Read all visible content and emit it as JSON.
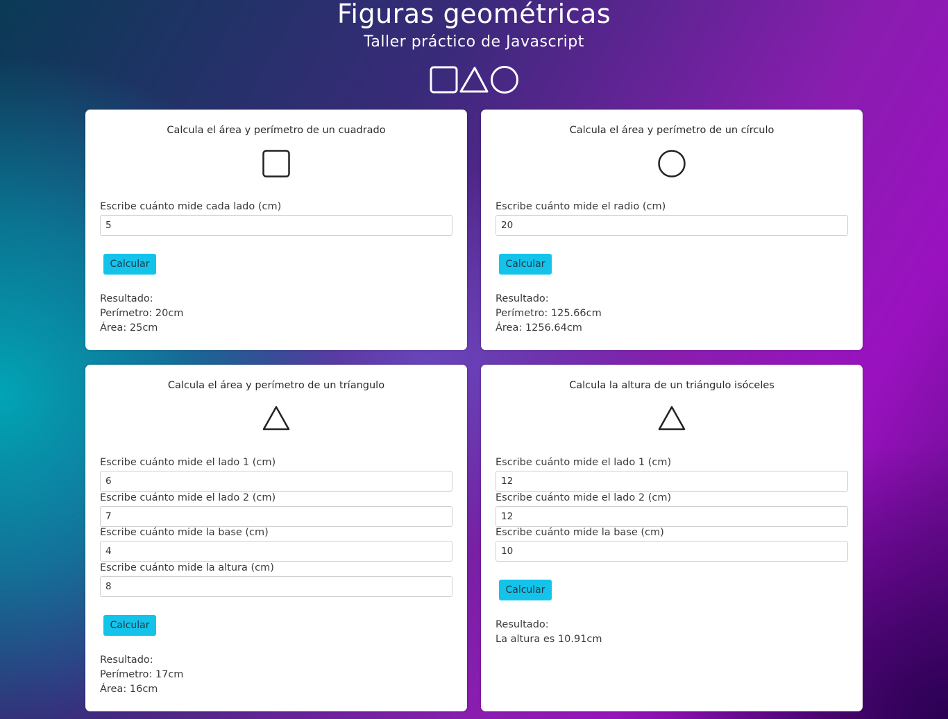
{
  "header": {
    "title": "Figuras geométricas",
    "subtitle": "Taller práctico de Javascript",
    "icons": [
      "square-icon",
      "triangle-icon",
      "circle-icon"
    ]
  },
  "colors": {
    "button": "#14c3ea",
    "card": "#ffffff",
    "text": "#2b2b2b"
  },
  "square": {
    "title": "Calcula el área y perímetro de un cuadrado",
    "icon": "square-icon",
    "side_label": "Escribe cuánto mide cada lado (cm)",
    "side_value": "5",
    "button": "Calcular",
    "result_label": "Resultado:",
    "perimeter": "Perímetro: 20cm",
    "area": "Área: 25cm"
  },
  "circle": {
    "title": "Calcula el área y perímetro de un círculo",
    "icon": "circle-icon",
    "radius_label": "Escribe cuánto mide el radio (cm)",
    "radius_value": "20",
    "button": "Calcular",
    "result_label": "Resultado:",
    "perimeter": "Perímetro: 125.66cm",
    "area": "Área: 1256.64cm"
  },
  "triangle": {
    "title": "Calcula el área y perímetro de un tríangulo",
    "icon": "triangle-icon",
    "side1_label": "Escribe cuánto mide el lado 1 (cm)",
    "side1_value": "6",
    "side2_label": "Escribe cuánto mide el lado 2 (cm)",
    "side2_value": "7",
    "base_label": "Escribe cuánto mide la base (cm)",
    "base_value": "4",
    "height_label": "Escribe cuánto mide la altura (cm)",
    "height_value": "8",
    "button": "Calcular",
    "result_label": "Resultado:",
    "perimeter": "Perímetro: 17cm",
    "area": "Área: 16cm"
  },
  "isosceles": {
    "title": "Calcula la altura de un triángulo isóceles",
    "icon": "triangle-icon",
    "side1_label": "Escribe cuánto mide el lado 1 (cm)",
    "side1_value": "12",
    "side2_label": "Escribe cuánto mide el lado 2 (cm)",
    "side2_value": "12",
    "base_label": "Escribe cuánto mide la base (cm)",
    "base_value": "10",
    "button": "Calcular",
    "result_label": "Resultado:",
    "height_result": "La altura es 10.91cm"
  }
}
